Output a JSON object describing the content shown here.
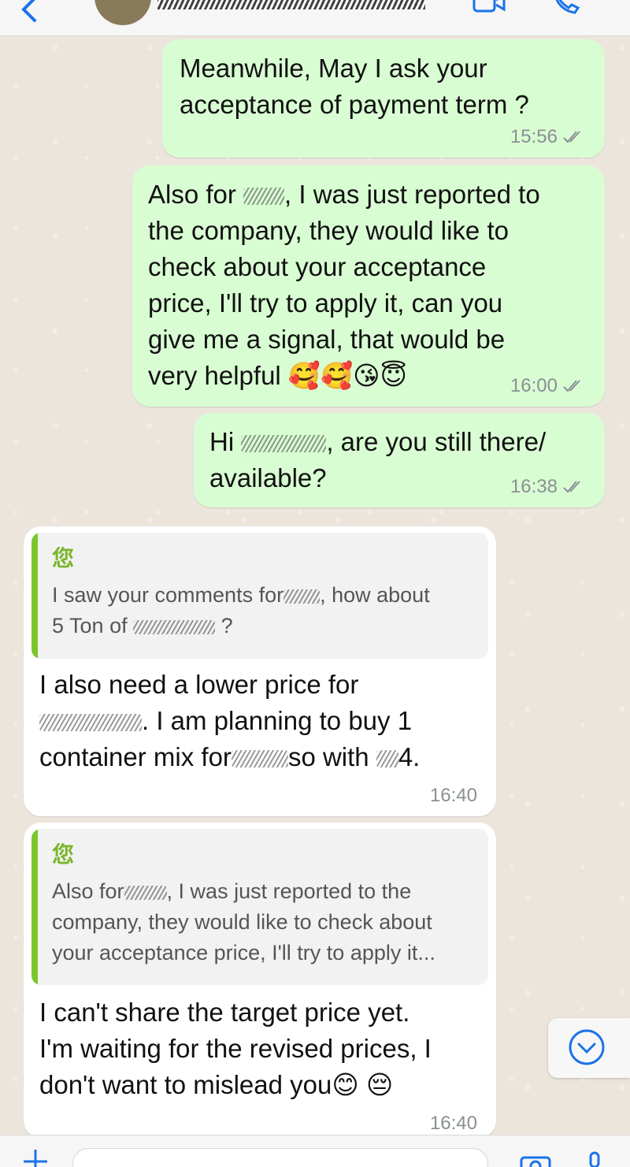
{
  "header": {
    "back_icon": "chevron-left-icon",
    "video_icon": "video-call-icon",
    "call_icon": "phone-icon"
  },
  "messages": [
    {
      "direction": "out",
      "text": "Meanwhile, May I ask your\nacceptance of payment term ?",
      "time": "15:56",
      "status": "read"
    },
    {
      "direction": "out",
      "line1_a": "Also for ",
      "line1_b": ", I was just reported to",
      "rest": "the company, they would like to\ncheck about your acceptance\nprice, I'll try to apply it, can you\ngive me a signal, that would be\nvery helpful 🥰🥰😘😇",
      "time": "16:00",
      "status": "read"
    },
    {
      "direction": "out",
      "line1_a": "Hi ",
      "line1_b": ", are you still there/",
      "line2": "available?",
      "time": "16:38",
      "status": "read"
    },
    {
      "direction": "in",
      "quote_author": "您",
      "quote_a": "I saw your comments for",
      "quote_b": ", how about",
      "quote_c": "5 Ton of",
      "quote_d": " ?",
      "line1": "I also need a lower price for",
      "line2_b": ". I am planning to buy 1",
      "line3_a": "container mix for",
      "line3_b": "so with",
      "line3_c": "4.",
      "time": "16:40"
    },
    {
      "direction": "in",
      "quote_author": "您",
      "quote_a": "Also for",
      "quote_b": ", I was just reported to the",
      "quote_rest": "company, they would like to check about\nyour acceptance price, I'll try to apply it...",
      "text": "I can't share the target price yet.\nI'm waiting for the revised prices, I\ndon't want to mislead you😊 😔",
      "time": "16:40"
    }
  ],
  "footer": {
    "plus_icon": "plus-icon",
    "camera_icon": "camera-icon",
    "mic_icon": "mic-icon"
  },
  "colors": {
    "outgoing_bubble": "#d9fdd3",
    "incoming_bubble": "#ffffff",
    "quote_accent": "#7bc62d",
    "timestamp": "#8a8f93",
    "read_tick": "#8a8f93"
  }
}
